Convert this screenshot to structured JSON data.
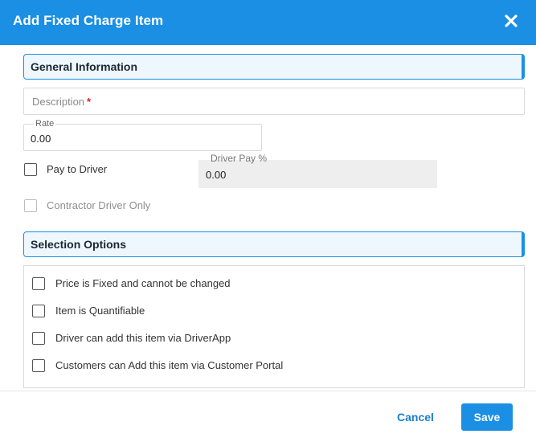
{
  "dialog": {
    "title": "Add Fixed Charge Item",
    "close_icon": "close-icon"
  },
  "general_section": {
    "title": "General Information",
    "description": {
      "placeholder": "Description",
      "required_marker": "*"
    },
    "rate": {
      "label": "Rate",
      "value": "0.00"
    },
    "pay_to_driver": {
      "label": "Pay to Driver",
      "checked": false
    },
    "driver_pay": {
      "label": "Driver Pay %",
      "value": "0.00"
    },
    "contractor_driver_only": {
      "label": "Contractor Driver Only",
      "checked": false,
      "disabled": true
    }
  },
  "selection_section": {
    "title": "Selection Options",
    "options": [
      {
        "label": "Price is Fixed and cannot be changed",
        "checked": false
      },
      {
        "label": "Item is Quantifiable",
        "checked": false
      },
      {
        "label": "Driver can add this item via DriverApp",
        "checked": false
      },
      {
        "label": "Customers can Add this item via Customer Portal",
        "checked": false
      }
    ]
  },
  "footer": {
    "cancel_label": "Cancel",
    "save_label": "Save"
  },
  "colors": {
    "accent": "#1a8fe3",
    "section_bg": "#eef7fd"
  }
}
